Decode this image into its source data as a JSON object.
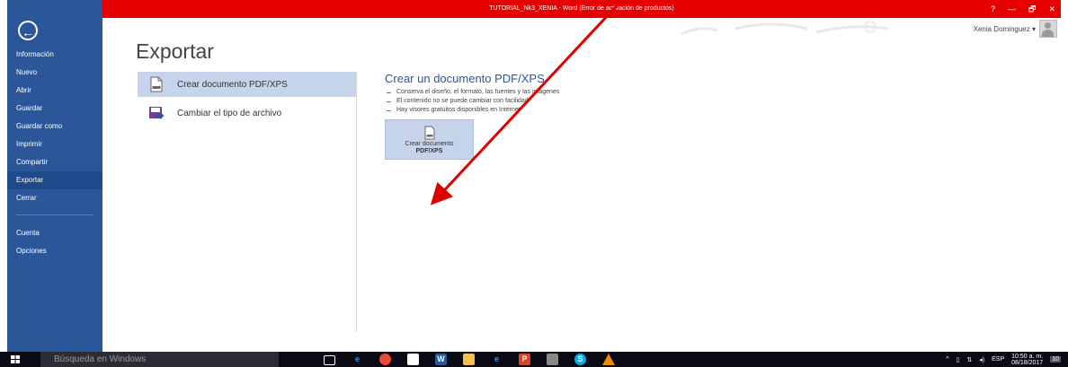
{
  "window": {
    "title": "TUTORIAL_Nk3_XENIA -  Word (Error de activación de productos)",
    "controls": [
      "?",
      "—",
      "🗗",
      "✕"
    ],
    "user_name": "Xenia Dominguez  ▾"
  },
  "backstage": {
    "items": [
      {
        "label": "Información"
      },
      {
        "label": "Nuevo"
      },
      {
        "label": "Abrir"
      },
      {
        "label": "Guardar"
      },
      {
        "label": "Guardar como"
      },
      {
        "label": "Imprimir"
      },
      {
        "label": "Compartir"
      },
      {
        "label": "Exportar"
      },
      {
        "label": "Cerrar"
      },
      {
        "label": "Cuenta"
      },
      {
        "label": "Opciones"
      }
    ],
    "active": "Exportar"
  },
  "page": {
    "title": "Exportar"
  },
  "options": [
    {
      "label": "Crear documento PDF/XPS",
      "icon": "pdf-document-icon",
      "selected": true
    },
    {
      "label": "Cambiar el tipo de archivo",
      "icon": "change-file-type-icon",
      "selected": false
    }
  ],
  "detail": {
    "title": "Crear un documento PDF/XPS",
    "bullets": [
      "Conserva el diseño, el formato, las fuentes y las imágenes",
      "El contenido no se puede cambiar con facilidad",
      "Hay visores gratuitos disponibles en Internet"
    ],
    "button_line1": "Crear documento",
    "button_line2": "PDF/XPS"
  },
  "taskbar": {
    "search_placeholder": "Búsqueda en Windows",
    "language": "ESP",
    "time": "10:50 a. m.",
    "date": "08/18/2017",
    "notifications": "10"
  },
  "colors": {
    "backstage_blue": "#2b579a",
    "titlebar_red": "#e60000",
    "selection": "#c5d4ea",
    "annotation_arrow": "#e00000"
  }
}
